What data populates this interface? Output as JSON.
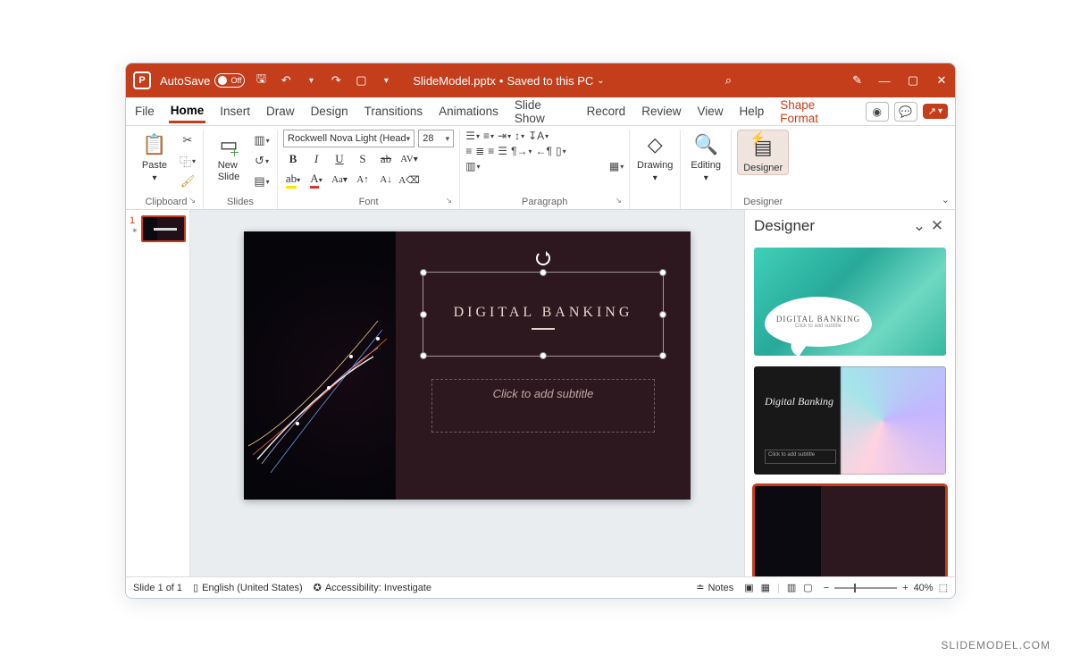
{
  "brand_color": "#c43e1c",
  "titlebar": {
    "autosave_label": "AutoSave",
    "autosave_state": "Off",
    "doc_name": "SlideModel.pptx",
    "saved_text": "Saved to this PC"
  },
  "tabs": {
    "file": "File",
    "items": [
      "Home",
      "Insert",
      "Draw",
      "Design",
      "Transitions",
      "Animations",
      "Slide Show",
      "Record",
      "Review",
      "View",
      "Help"
    ],
    "active": "Home",
    "context": "Shape Format"
  },
  "ribbon": {
    "clipboard": {
      "name": "Clipboard",
      "paste": "Paste"
    },
    "slides": {
      "name": "Slides",
      "new_slide": "New\nSlide"
    },
    "font": {
      "name": "Font",
      "family": "Rockwell Nova Light (Head",
      "size": "28"
    },
    "paragraph": {
      "name": "Paragraph"
    },
    "drawing": {
      "label": "Drawing"
    },
    "editing": {
      "label": "Editing"
    },
    "designer": {
      "name": "Designer",
      "button": "Designer"
    }
  },
  "thumb": {
    "number": "1"
  },
  "slide": {
    "title": "DIGITAL BANKING",
    "subtitle_placeholder": "Click to add subtitle"
  },
  "designer_pane": {
    "title": "Designer",
    "card1_title": "DIGITAL BANKING",
    "card1_sub": "Click to add subtitle",
    "card2_title": "Digital Banking",
    "card2_sub": "Click to add subtitle"
  },
  "status": {
    "slide_of": "Slide 1 of 1",
    "lang": "English (United States)",
    "access": "Accessibility: Investigate",
    "notes": "Notes",
    "zoom": "40%"
  },
  "watermark": "SLIDEMODEL.COM"
}
